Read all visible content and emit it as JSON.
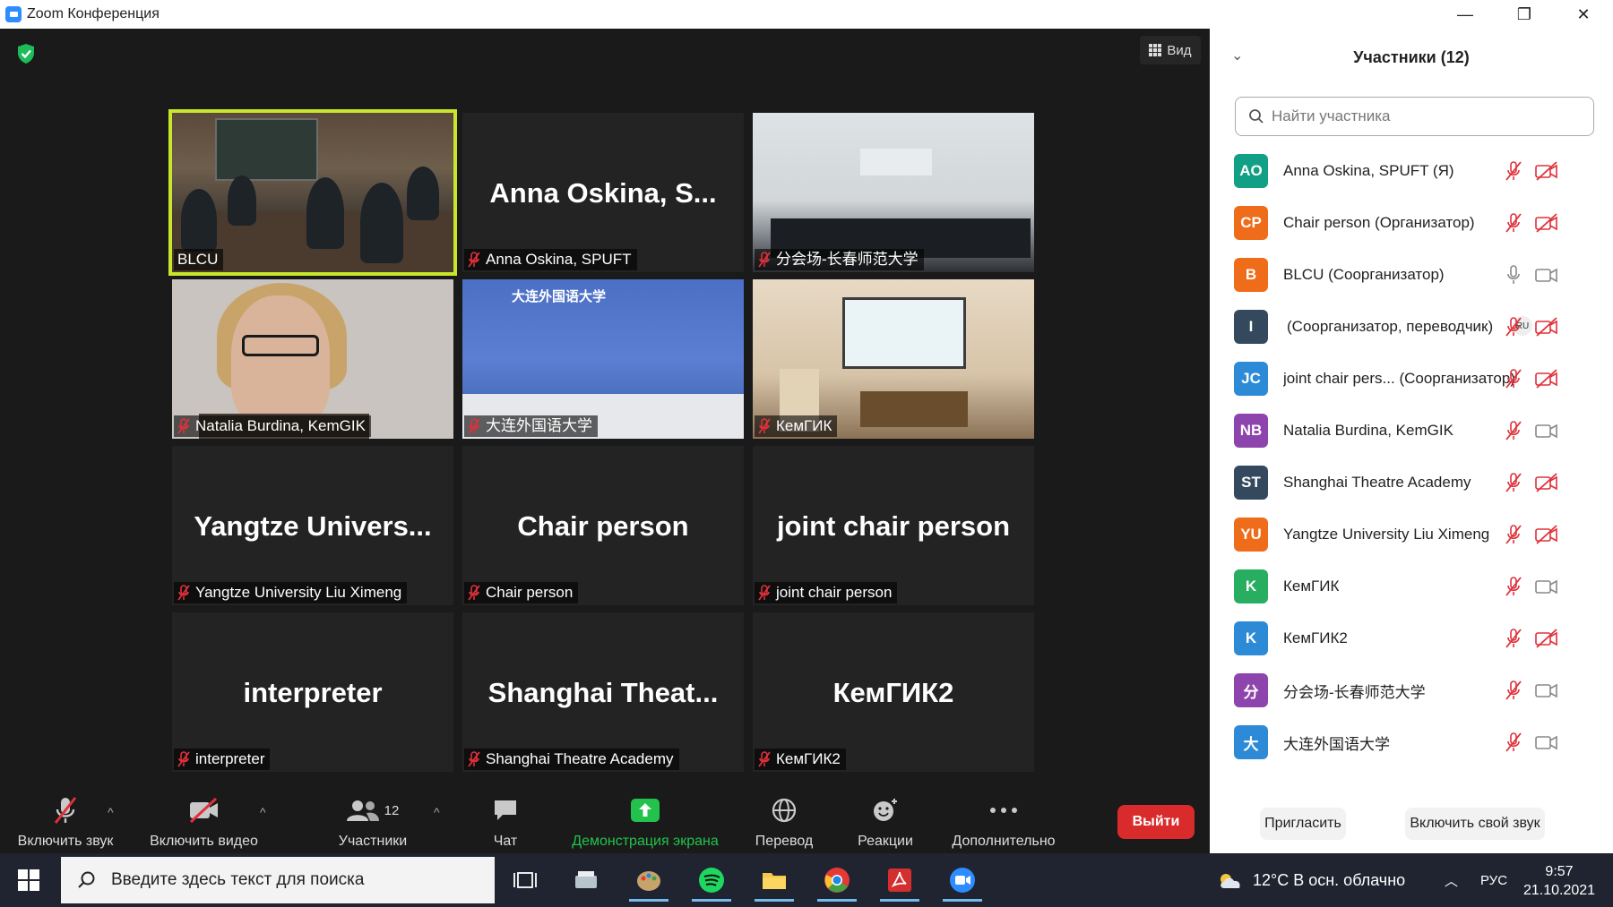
{
  "window": {
    "title": "Zoom Конференция",
    "minimize": "—",
    "restore": "❐",
    "close": "✕"
  },
  "meeting": {
    "view_label": "Вид",
    "tiles": [
      {
        "id": "blcu",
        "label": "BLCU",
        "big": "",
        "video": true,
        "active": true,
        "muted": false
      },
      {
        "id": "anna",
        "label": "Anna Oskina, SPUFT",
        "big": "Anna  Oskina,  S...",
        "video": false,
        "muted": true
      },
      {
        "id": "cc",
        "label": "分会场-长春师范大学",
        "big": "",
        "video": true,
        "muted": true
      },
      {
        "id": "nb",
        "label": "Natalia Burdina, KemGIK",
        "big": "",
        "video": true,
        "muted": true
      },
      {
        "id": "dl",
        "label": "大连外国语大学",
        "big": "",
        "video": true,
        "muted": true,
        "banner": "大连外国语大学"
      },
      {
        "id": "kg",
        "label": "КемГИК",
        "big": "",
        "video": true,
        "muted": true
      },
      {
        "id": "yu",
        "label": "Yangtze University Liu Ximeng",
        "big": "Yangtze  Univers...",
        "video": false,
        "muted": true
      },
      {
        "id": "cp",
        "label": "Chair person",
        "big": "Chair person",
        "video": false,
        "muted": true
      },
      {
        "id": "jc",
        "label": "joint chair person",
        "big": "joint chair person",
        "video": false,
        "muted": true
      },
      {
        "id": "int",
        "label": "interpreter",
        "big": "interpreter",
        "video": false,
        "muted": true
      },
      {
        "id": "st",
        "label": "Shanghai Theatre Academy",
        "big": "Shanghai  Theat...",
        "video": false,
        "muted": true
      },
      {
        "id": "kg2",
        "label": "КемГИК2",
        "big": "КемГИК2",
        "video": false,
        "muted": true
      }
    ]
  },
  "toolbar": {
    "unmute": "Включить звук",
    "video": "Включить видео",
    "participants": "Участники",
    "participants_count": "12",
    "chat": "Чат",
    "share": "Демонстрация экрана",
    "translate": "Перевод",
    "reactions": "Реакции",
    "more": "Дополнительно",
    "leave": "Выйти"
  },
  "panel": {
    "title": "Участники (12)",
    "search_placeholder": "Найти участника",
    "invite": "Пригласить",
    "unmute_me": "Включить свой звук",
    "participants": [
      {
        "initials": "AO",
        "color": "#11a085",
        "name": "Anna Oskina, SPUFT (Я)",
        "mic": "off",
        "cam": "off"
      },
      {
        "initials": "CP",
        "color": "#ef6c1a",
        "name": "Chair person (Организатор)",
        "mic": "off",
        "cam": "off"
      },
      {
        "initials": "B",
        "color": "#ef6c1a",
        "name": "BLCU (Соорганизатор)",
        "mic": "on",
        "cam": "on"
      },
      {
        "initials": "I",
        "color": "#34495e",
        "name": "(Соорганизатор, переводчик)",
        "mic": "off",
        "cam": "off",
        "badge": "RU"
      },
      {
        "initials": "JC",
        "color": "#2d8ad6",
        "name": "joint chair pers...  (Соорганизатор)",
        "mic": "off",
        "cam": "off"
      },
      {
        "initials": "NB",
        "color": "#8e44ad",
        "name": "Natalia Burdina, KemGIK",
        "mic": "off",
        "cam": "on"
      },
      {
        "initials": "ST",
        "color": "#34495e",
        "name": "Shanghai Theatre Academy",
        "mic": "off",
        "cam": "off"
      },
      {
        "initials": "YU",
        "color": "#ef6c1a",
        "name": "Yangtze University Liu Ximeng",
        "mic": "off",
        "cam": "off"
      },
      {
        "initials": "K",
        "color": "#27ae60",
        "name": "КемГИК",
        "mic": "off",
        "cam": "on"
      },
      {
        "initials": "K",
        "color": "#2d8ad6",
        "name": "КемГИК2",
        "mic": "off",
        "cam": "off"
      },
      {
        "initials": "分",
        "color": "#8e44ad",
        "name": "分会场-长春师范大学",
        "mic": "off",
        "cam": "on"
      },
      {
        "initials": "大",
        "color": "#2d8ad6",
        "name": "大连外国语大学",
        "mic": "off",
        "cam": "on"
      }
    ]
  },
  "taskbar": {
    "search_placeholder": "Введите здесь текст для поиска",
    "weather": "12°C  В осн. облачно",
    "lang": "РУС",
    "time": "9:57",
    "date": "21.10.2021"
  },
  "colors": {
    "active_speaker": "#c8e62b",
    "muted_red": "#e0303a",
    "share_green": "#22c24c",
    "leave_red": "#d92b2b"
  }
}
